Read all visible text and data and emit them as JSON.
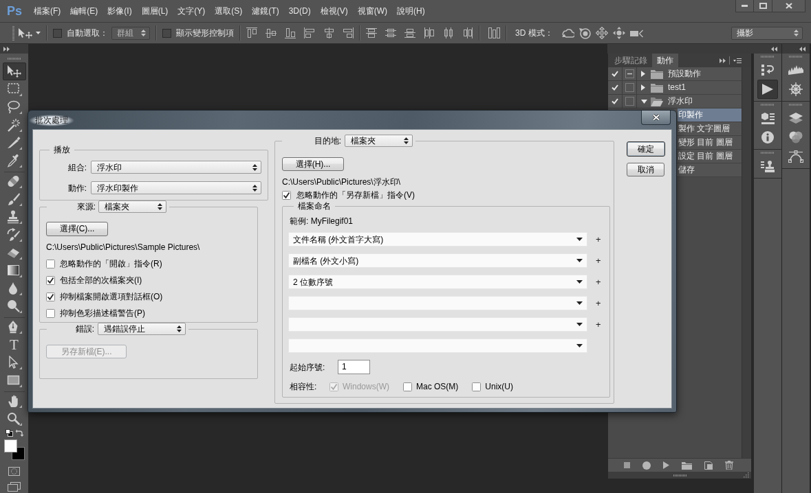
{
  "app": {
    "logo": "Ps"
  },
  "menu": [
    "檔案(F)",
    "編輯(E)",
    "影像(I)",
    "圖層(L)",
    "文字(Y)",
    "選取(S)",
    "濾鏡(T)",
    "3D(D)",
    "檢視(V)",
    "視窗(W)",
    "說明(H)"
  ],
  "options_bar": {
    "auto_select": {
      "label": "自動選取：",
      "checked": false,
      "value": "群組",
      "disabled": true
    },
    "show_transform_controls": {
      "label": "顯示變形控制項",
      "checked": false
    },
    "mode_3d": {
      "label": "3D 模式："
    },
    "workspace": {
      "value": "攝影"
    }
  },
  "tools": [
    {
      "selected": true
    },
    {
      "selected": false
    },
    {
      "selected": false
    },
    {
      "selected": false
    },
    {
      "selected": false
    },
    {
      "selected": false
    },
    {
      "selected": false
    },
    {
      "selected": false
    },
    {
      "selected": false
    },
    {
      "selected": false
    },
    {
      "selected": false
    },
    {
      "selected": false
    },
    {
      "selected": false
    },
    {
      "selected": false
    },
    {
      "selected": false
    },
    {
      "selected": false,
      "glyph": "T"
    },
    {
      "selected": false
    },
    {
      "selected": false
    },
    {
      "selected": false
    },
    {
      "selected": false
    }
  ],
  "color_swatches": [
    {
      "color": "#ffffff"
    },
    {
      "color": "#000000"
    }
  ],
  "actions_panel": {
    "tabs": [
      {
        "label": "步驟記錄",
        "selected": false
      },
      {
        "label": "動作",
        "selected": true
      }
    ],
    "items": [
      {
        "label": "預設動作",
        "checked": true,
        "dialog_partial": true,
        "expanded": false,
        "selected": false
      },
      {
        "label": "test1",
        "checked": true,
        "dialog_partial": false,
        "expanded": false,
        "selected": false
      },
      {
        "label": "浮水印",
        "checked": true,
        "dialog_partial": false,
        "expanded": true,
        "selected": false,
        "children": [
          {
            "label": "印製作",
            "selected": true,
            "children": [
              {
                "label": "製作 文字圖層",
                "selected": false
              },
              {
                "label": "變形 目前 圖層",
                "selected": false
              },
              {
                "label": "設定 目前 圖層",
                "selected": false
              },
              {
                "label": "儲存",
                "selected": false
              }
            ]
          }
        ]
      }
    ]
  },
  "panel_icons": [
    {
      "selected": false
    },
    {
      "selected": true
    },
    {
      "selected": false
    },
    {
      "selected": false
    },
    {
      "selected": false
    },
    {
      "selected": false
    },
    {
      "selected": false
    },
    {
      "selected": false
    },
    {
      "selected": false
    },
    {
      "selected": false
    }
  ],
  "dialog": {
    "title": "批次處理",
    "play": {
      "legend": "播放",
      "set": {
        "label": "組合:",
        "value": "浮水印"
      },
      "action": {
        "label": "動作:",
        "value": "浮水印製作"
      }
    },
    "source": {
      "label": "來源:",
      "value": "檔案夾",
      "choose_button": "選擇(C)...",
      "path": "C:\\Users\\Public\\Pictures\\Sample Pictures\\",
      "options": [
        {
          "label": "忽略動作的「開啟」指令(R)",
          "checked": false
        },
        {
          "label": "包括全部的次檔案夾(I)",
          "checked": true
        },
        {
          "label": "抑制檔案開啟選項對話框(O)",
          "checked": true
        },
        {
          "label": "抑制色彩描述檔警告(P)",
          "checked": false
        }
      ]
    },
    "errors": {
      "label": "錯誤:",
      "value": "遇錯誤停止",
      "save_as_button": {
        "label": "另存新檔(E)...",
        "disabled": true
      }
    },
    "destination": {
      "label": "目的地:",
      "value": "檔案夾",
      "choose_button": "選擇(H)...",
      "path": "C:\\Users\\Public\\Pictures\\浮水印\\",
      "override_save": {
        "label": "忽略動作的「另存新檔」指令(V)",
        "checked": true
      },
      "file_naming": {
        "legend": "檔案命名",
        "example": "範例: MyFilegif01",
        "fields": [
          {
            "value": "文件名稱 (外文首字大寫)",
            "add": "+",
            "disabled": false
          },
          {
            "value": "副檔名 (外文小寫)",
            "add": "+",
            "disabled": false
          },
          {
            "value": "2 位數序號",
            "add": "+",
            "disabled": false
          },
          {
            "add": "+",
            "disabled": false
          },
          {
            "add": "+",
            "disabled": false
          },
          {
            "disabled": false
          }
        ],
        "start_serial": {
          "label": "起始序號:",
          "value": "1"
        },
        "compatibility": {
          "label": "相容性:",
          "options": [
            {
              "label": "Windows(W)",
              "checked": true,
              "disabled": true
            },
            {
              "label": "Mac OS(M)",
              "checked": false,
              "disabled": false
            },
            {
              "label": "Unix(U)",
              "checked": false,
              "disabled": false
            }
          ]
        }
      }
    },
    "buttons": [
      {
        "label": "確定",
        "default": true
      },
      {
        "label": "取消",
        "default": false
      }
    ]
  }
}
